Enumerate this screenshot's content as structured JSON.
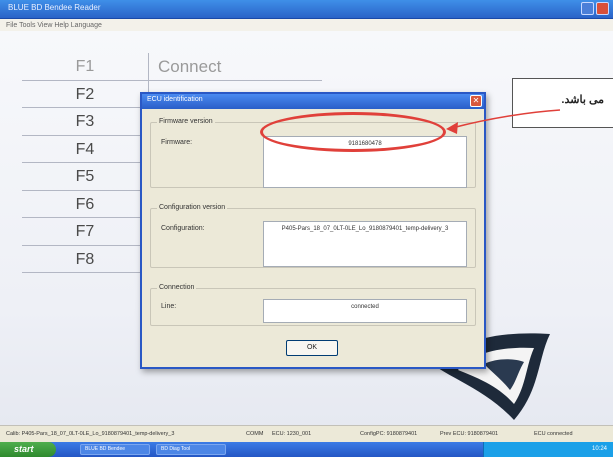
{
  "window": {
    "title": "BLUE BD Bendee Reader",
    "menu": "File   Tools   View   Help   Language"
  },
  "fkeys": [
    {
      "key": "F1",
      "label": "Connect"
    },
    {
      "key": "F2",
      "label": ""
    },
    {
      "key": "F3",
      "label": ""
    },
    {
      "key": "F4",
      "label": ""
    },
    {
      "key": "F5",
      "label": ""
    },
    {
      "key": "F6",
      "label": ""
    },
    {
      "key": "F7",
      "label": ""
    },
    {
      "key": "F8",
      "label": ""
    }
  ],
  "dialog": {
    "title": "ECU identification",
    "firmware": {
      "section": "Firmware version",
      "label": "Firmware:",
      "value": "9181680478"
    },
    "configuration": {
      "section": "Configuration version",
      "label": "Configuration:",
      "value": "P405-Pars_18_07_0LT-0LE_Lo_9180879401_temp-delivery_3"
    },
    "connection": {
      "section": "Connection",
      "label": "Line:",
      "value": "connected"
    },
    "ok_label": "OK"
  },
  "annotation": {
    "text": "می باشد.",
    "color": "#e0403a"
  },
  "statusbar": {
    "calib": "Calib: P405-Pars_18_07_0LT-0LE_Lo_9180879401_temp-delivery_3",
    "comm": "COMM",
    "ecu": "ECU: 1230_001",
    "config": "ConfigPC: 9180879401",
    "prev": "Prev ECU: 9180879401",
    "status": "ECU connected"
  },
  "taskbar": {
    "start": "start",
    "tasks": [
      "BLUE BD Bendee",
      "BD Diag Tool"
    ],
    "clock": "10:24"
  },
  "colors": {
    "titlebar": "#2a63c8",
    "dialog_bg": "#ece9d8",
    "accent_red": "#e0403a"
  }
}
